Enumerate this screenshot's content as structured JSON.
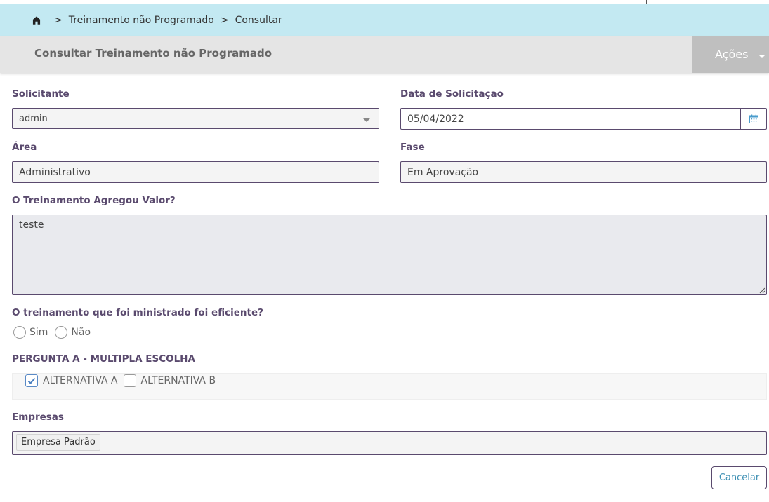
{
  "breadcrumb": {
    "home_icon": "home-icon",
    "separator": ">",
    "items": [
      "Treinamento não Programado",
      "Consultar"
    ]
  },
  "header": {
    "title": "Consultar Treinamento não Programado",
    "actions_label": "Ações"
  },
  "form": {
    "solicitante": {
      "label": "Solicitante",
      "value": "admin"
    },
    "data_solicitacao": {
      "label": "Data de Solicitação",
      "value": "05/04/2022",
      "icon": "calendar-icon"
    },
    "area": {
      "label": "Área",
      "value": "Administrativo"
    },
    "fase": {
      "label": "Fase",
      "value": "Em Aprovação"
    },
    "agregou_valor": {
      "label": "O Treinamento Agregou Valor?",
      "value": "teste"
    },
    "eficiente": {
      "label": "O treinamento que foi ministrado foi eficiente?",
      "options": [
        "Sim",
        "Não"
      ],
      "selected": null
    },
    "pergunta_a": {
      "label": "PERGUNTA A - MULTIPLA ESCOLHA",
      "options": [
        {
          "label": "ALTERNATIVA A",
          "checked": true
        },
        {
          "label": "ALTERNATIVA B",
          "checked": false
        }
      ]
    },
    "empresas": {
      "label": "Empresas",
      "tags": [
        "Empresa Padrão"
      ]
    }
  },
  "buttons": {
    "cancel_label": "Cancelar"
  },
  "colors": {
    "breadcrumb_bg": "#c3e9f2",
    "title_bar_bg": "#e5e5e5",
    "actions_bg": "#bfbfbf",
    "label_color": "#5a4a6e",
    "link_color": "#3c8fb3"
  }
}
